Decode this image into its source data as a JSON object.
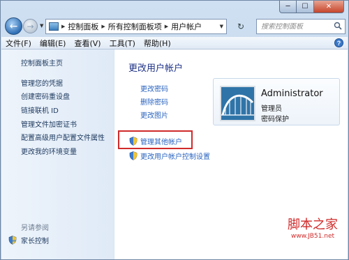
{
  "window": {
    "caption": {
      "min": "─",
      "max": "☐",
      "close": "✕"
    }
  },
  "nav": {
    "back": "←",
    "forward": "→",
    "breadcrumbs": [
      "控制面板",
      "所有控制面板项",
      "用户帐户"
    ],
    "search_placeholder": "搜索控制面板",
    "refresh": "↻"
  },
  "menu": [
    "文件(F)",
    "编辑(E)",
    "查看(V)",
    "工具(T)",
    "帮助(H)"
  ],
  "sidebar": {
    "home": "控制面板主页",
    "links": [
      "管理您的凭据",
      "创建密码重设盘",
      "链接联机 ID",
      "管理文件加密证书",
      "配置高级用户配置文件属性",
      "更改我的环境变量"
    ],
    "see_also": "另请参阅",
    "family": "家长控制"
  },
  "main": {
    "title": "更改用户帐户",
    "links": [
      "更改密码",
      "删除密码",
      "更改图片"
    ],
    "shield_links": [
      "管理其他帐户",
      "更改用户帐户控制设置"
    ]
  },
  "account": {
    "name": "Administrator",
    "role": "管理员",
    "status": "密码保护"
  },
  "watermark": {
    "title": "脚本之家",
    "url": "www.JB51.net"
  },
  "colors": {
    "link": "#2a64c0",
    "title": "#1e3287",
    "highlight": "#d02a2a"
  }
}
